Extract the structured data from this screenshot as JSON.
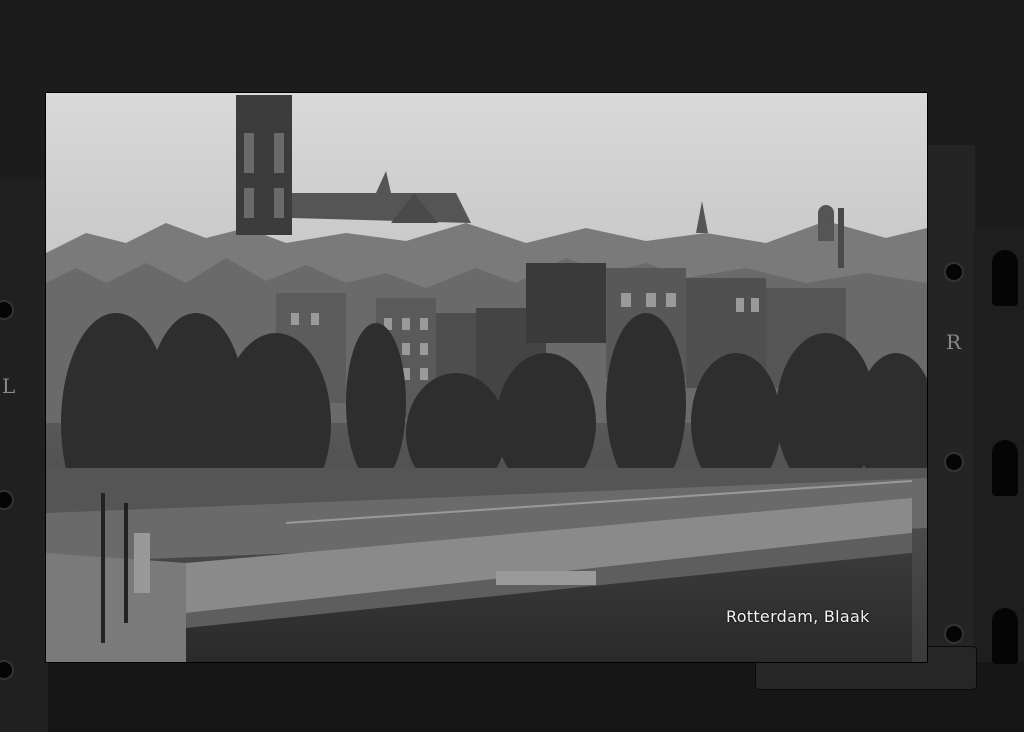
{
  "photo": {
    "caption": "Rotterdam, Blaak",
    "description_icon": "photo-postcard-icon"
  },
  "holder": {
    "left_letter": "L",
    "right_letter": "R"
  },
  "colors": {
    "sky": "#d8d8d8",
    "buildings": "#4a4a4a",
    "water": "#2a2a2a",
    "frame": "#1c1c1c"
  }
}
